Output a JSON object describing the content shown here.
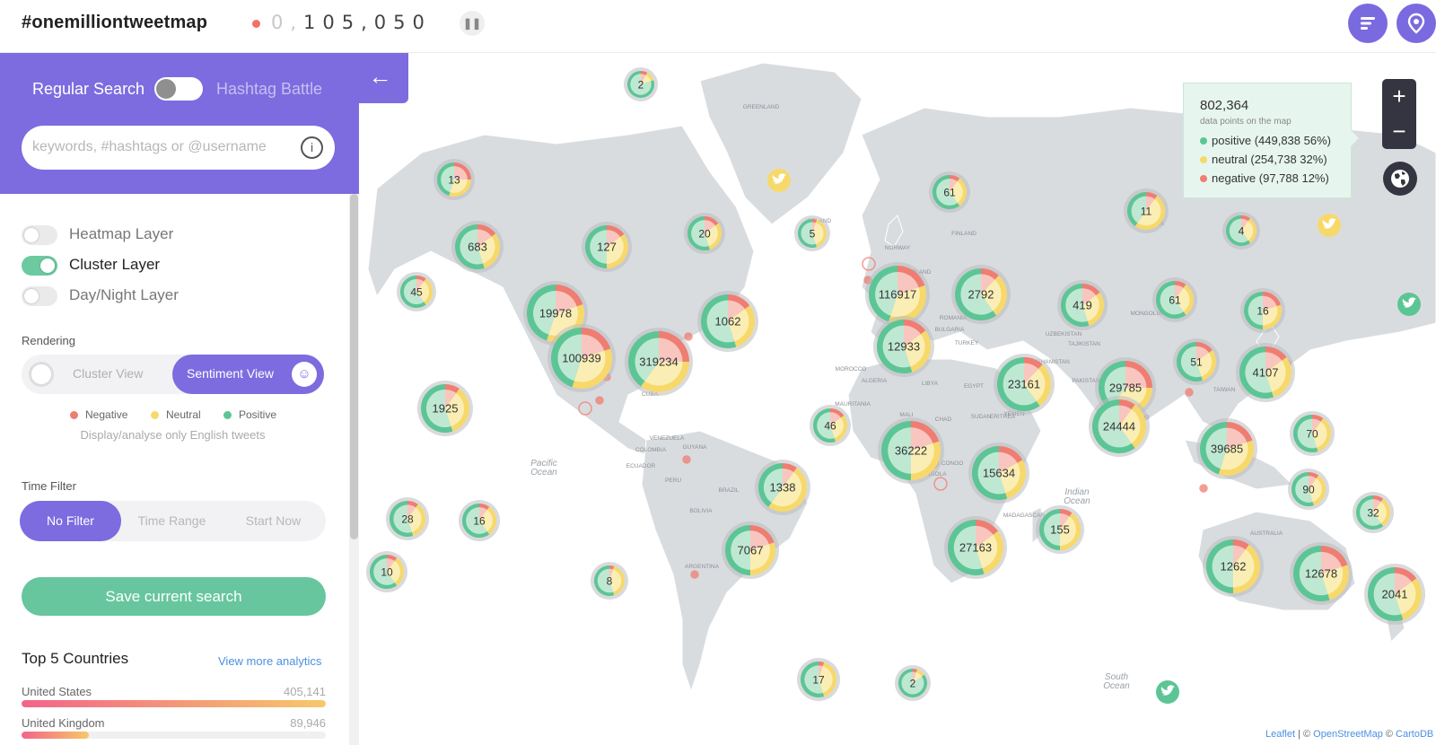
{
  "header": {
    "brand": "#onemilliontweetmap",
    "counter_dim": "0,",
    "counter_main": "105,050",
    "pause_icon": "pause-icon",
    "menu_icon": "list-icon",
    "location_icon": "location-pin-icon"
  },
  "sidebar": {
    "mode_left": "Regular Search",
    "mode_right": "Hashtag Battle",
    "search_placeholder": "keywords, #hashtags or @username",
    "info_icon": "i",
    "layers": [
      {
        "label": "Heatmap Layer",
        "on": false
      },
      {
        "label": "Cluster Layer",
        "on": true
      },
      {
        "label": "Day/Night Layer",
        "on": false
      }
    ],
    "rendering_title": "Rendering",
    "render_options": {
      "cluster": "Cluster View",
      "sentiment": "Sentiment View",
      "active": "Sentiment View"
    },
    "legend": [
      {
        "label": "Negative",
        "color": "#ef7d72"
      },
      {
        "label": "Neutral",
        "color": "#f7d96b"
      },
      {
        "label": "Positive",
        "color": "#5cc595"
      }
    ],
    "note": "Display/analyse only English tweets",
    "time_filter_title": "Time Filter",
    "time_options": [
      "No Filter",
      "Time Range",
      "Start Now"
    ],
    "save_button": "Save current search",
    "top5_title": "Top 5 Countries",
    "analytics_link": "View more analytics",
    "countries": [
      {
        "name": "United States",
        "value": "405,141",
        "fraction": 1.0
      },
      {
        "name": "United Kingdom",
        "value": "89,946",
        "fraction": 0.22
      }
    ]
  },
  "map": {
    "ocean_color": "#ffffff",
    "land_color": "#d9dcdf",
    "colors": {
      "positive": "#5cc595",
      "neutral": "#f7d96b",
      "negative": "#ef7d72"
    },
    "place_labels": [
      "GREENLAND",
      "ICELAND",
      "NORWAY",
      "FINLAND",
      "RUSSIA",
      "MONGOLIA",
      "UZBEKISTAN",
      "TAJIKISTAN",
      "AFGHANISTAN",
      "PAKISTAN",
      "BANGLADESH",
      "LAOS",
      "TAIWAN",
      "TURKEY",
      "ROMANIA",
      "BULGARIA",
      "POLAND",
      "MOROCCO",
      "ALGERIA",
      "LIBYA",
      "EGYPT",
      "MAURITANIA",
      "MALI",
      "CHAD",
      "SUDAN",
      "ERITREA",
      "YEMEN",
      "DEM. REP. CONGO",
      "ANGOLA",
      "MADAGASCAR",
      "AUSTRALIA",
      "PERU",
      "BRAZIL",
      "BOLIVIA",
      "ARGENTINA",
      "VENEZUELA",
      "GUYANA",
      "COLOMBIA",
      "ECUADOR",
      "CUBA",
      "Pacific Ocean",
      "Indian Ocean",
      "South Ocean"
    ],
    "clusters": [
      {
        "label": "2",
        "pos": 0.8,
        "neu": 0.12,
        "neg": 0.08
      },
      {
        "label": "13",
        "pos": 0.45,
        "neu": 0.3,
        "neg": 0.25
      },
      {
        "label": "683",
        "pos": 0.55,
        "neu": 0.3,
        "neg": 0.15
      },
      {
        "label": "45",
        "pos": 0.6,
        "neu": 0.3,
        "neg": 0.1
      },
      {
        "label": "127",
        "pos": 0.5,
        "neu": 0.35,
        "neg": 0.15
      },
      {
        "label": "20",
        "pos": 0.55,
        "neu": 0.3,
        "neg": 0.15
      },
      {
        "label": "5",
        "pos": 0.55,
        "neu": 0.4,
        "neg": 0.05
      },
      {
        "label": "61",
        "pos": 0.6,
        "neu": 0.3,
        "neg": 0.1
      },
      {
        "label": "11",
        "pos": 0.4,
        "neu": 0.5,
        "neg": 0.1
      },
      {
        "label": "4",
        "pos": 0.6,
        "neu": 0.3,
        "neg": 0.1
      },
      {
        "label": "19978",
        "pos": 0.45,
        "neu": 0.35,
        "neg": 0.2
      },
      {
        "label": "100939",
        "pos": 0.45,
        "neu": 0.35,
        "neg": 0.2
      },
      {
        "label": "319234",
        "pos": 0.4,
        "neu": 0.35,
        "neg": 0.25
      },
      {
        "label": "1062",
        "pos": 0.55,
        "neu": 0.3,
        "neg": 0.15
      },
      {
        "label": "116917",
        "pos": 0.45,
        "neu": 0.35,
        "neg": 0.2
      },
      {
        "label": "2792",
        "pos": 0.6,
        "neu": 0.28,
        "neg": 0.12
      },
      {
        "label": "419",
        "pos": 0.55,
        "neu": 0.3,
        "neg": 0.15
      },
      {
        "label": "61",
        "pos": 0.6,
        "neu": 0.3,
        "neg": 0.1
      },
      {
        "label": "16",
        "pos": 0.5,
        "neu": 0.3,
        "neg": 0.2
      },
      {
        "label": "12933",
        "pos": 0.55,
        "neu": 0.3,
        "neg": 0.15
      },
      {
        "label": "1925",
        "pos": 0.55,
        "neu": 0.35,
        "neg": 0.1
      },
      {
        "label": "23161",
        "pos": 0.6,
        "neu": 0.28,
        "neg": 0.12
      },
      {
        "label": "51",
        "pos": 0.55,
        "neu": 0.3,
        "neg": 0.15
      },
      {
        "label": "4107",
        "pos": 0.55,
        "neu": 0.3,
        "neg": 0.15
      },
      {
        "label": "29785",
        "pos": 0.4,
        "neu": 0.35,
        "neg": 0.25
      },
      {
        "label": "46",
        "pos": 0.55,
        "neu": 0.3,
        "neg": 0.15
      },
      {
        "label": "36222",
        "pos": 0.5,
        "neu": 0.3,
        "neg": 0.2
      },
      {
        "label": "15634",
        "pos": 0.55,
        "neu": 0.28,
        "neg": 0.17
      },
      {
        "label": "24444",
        "pos": 0.6,
        "neu": 0.3,
        "neg": 0.1
      },
      {
        "label": "39685",
        "pos": 0.45,
        "neu": 0.35,
        "neg": 0.2
      },
      {
        "label": "70",
        "pos": 0.55,
        "neu": 0.35,
        "neg": 0.1
      },
      {
        "label": "1338",
        "pos": 0.4,
        "neu": 0.5,
        "neg": 0.1
      },
      {
        "label": "90",
        "pos": 0.55,
        "neu": 0.35,
        "neg": 0.1
      },
      {
        "label": "32",
        "pos": 0.6,
        "neu": 0.3,
        "neg": 0.1
      },
      {
        "label": "28",
        "pos": 0.55,
        "neu": 0.35,
        "neg": 0.1
      },
      {
        "label": "16",
        "pos": 0.6,
        "neu": 0.3,
        "neg": 0.1
      },
      {
        "label": "7067",
        "pos": 0.5,
        "neu": 0.3,
        "neg": 0.2
      },
      {
        "label": "155",
        "pos": 0.5,
        "neu": 0.4,
        "neg": 0.1
      },
      {
        "label": "27163",
        "pos": 0.55,
        "neu": 0.3,
        "neg": 0.15
      },
      {
        "label": "1262",
        "pos": 0.5,
        "neu": 0.4,
        "neg": 0.1
      },
      {
        "label": "12678",
        "pos": 0.55,
        "neu": 0.25,
        "neg": 0.2
      },
      {
        "label": "2041",
        "pos": 0.55,
        "neu": 0.3,
        "neg": 0.15
      },
      {
        "label": "10",
        "pos": 0.6,
        "neu": 0.3,
        "neg": 0.1
      },
      {
        "label": "8",
        "pos": 0.55,
        "neu": 0.4,
        "neg": 0.05
      },
      {
        "label": "17",
        "pos": 0.55,
        "neu": 0.4,
        "neg": 0.05
      },
      {
        "label": "2",
        "pos": 0.85,
        "neu": 0.1,
        "neg": 0.05
      }
    ],
    "twitter_icon": "twitter-bird-icon"
  },
  "tooltip": {
    "total": "802,364",
    "subtitle": "data points on the map",
    "rows": [
      {
        "text": "positive (449,838 56%)",
        "color": "#5cc595"
      },
      {
        "text": "neutral (254,738 32%)",
        "color": "#f7d96b"
      },
      {
        "text": "negative (97,788 12%)",
        "color": "#ef7d72"
      }
    ]
  },
  "controls": {
    "zoom_in": "+",
    "zoom_out": "−",
    "globe_icon": "globe-icon"
  },
  "attribution": {
    "leaflet": "Leaflet",
    "sep1": " | © ",
    "osm": "OpenStreetMap",
    "sep2": " © ",
    "carto": "CartoDB"
  }
}
